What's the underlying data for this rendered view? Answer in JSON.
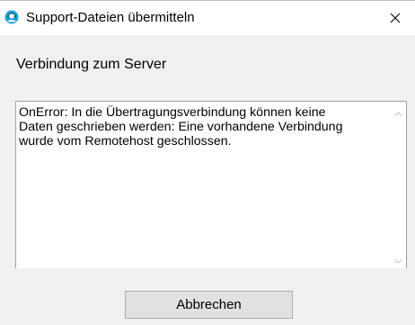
{
  "window": {
    "title": "Support-Dateien übermitteln",
    "icon": "support-agent-icon",
    "close_icon": "close-icon"
  },
  "main": {
    "heading": "Verbindung zum Server",
    "message": "OnError: In die Übertragungsverbindung können keine\nDaten geschrieben werden: Eine vorhandene Verbindung\nwurde vom Remotehost geschlossen."
  },
  "scrollbar": {
    "up_icon": "chevron-up-icon",
    "down_icon": "chevron-down-icon"
  },
  "buttons": {
    "cancel_label": "Abbrechen"
  },
  "colors": {
    "accent": "#1fa0d8",
    "window_background": "#f0f0f0",
    "button_background": "#e1e1e1"
  }
}
